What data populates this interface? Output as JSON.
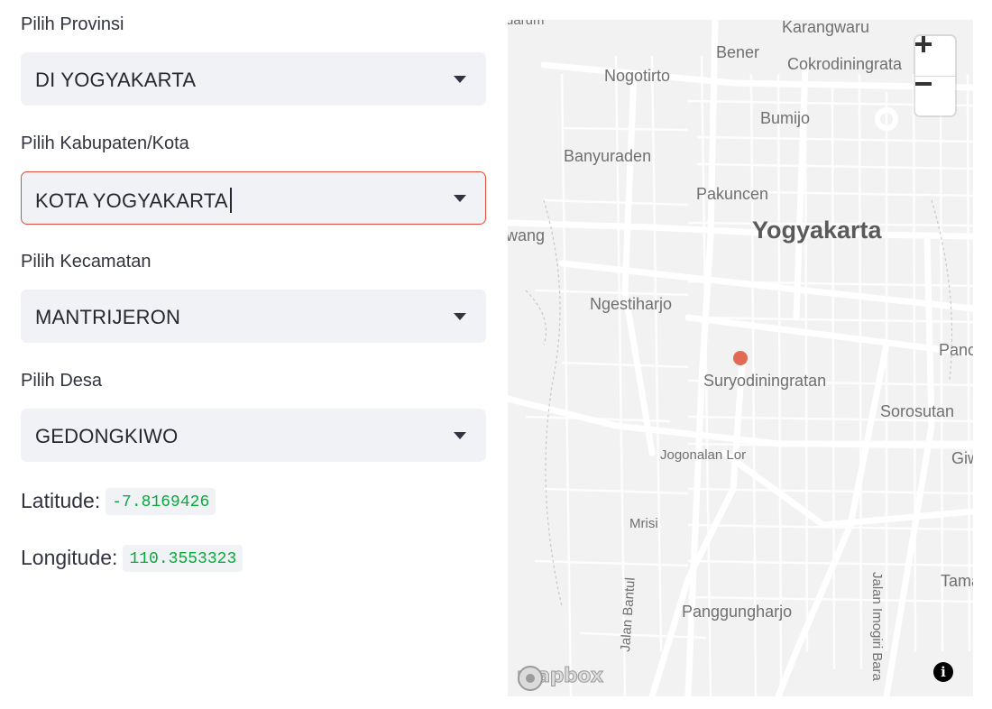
{
  "form": {
    "provinsi": {
      "label": "Pilih Provinsi",
      "value": "DI YOGYAKARTA"
    },
    "kabupaten": {
      "label": "Pilih Kabupaten/Kota",
      "value": "KOTA YOGYAKARTA"
    },
    "kecamatan": {
      "label": "Pilih Kecamatan",
      "value": "MANTRIJERON"
    },
    "desa": {
      "label": "Pilih Desa",
      "value": "GEDONGKIWO"
    }
  },
  "coords": {
    "latitude_label": "Latitude:",
    "latitude": "-7.8169426",
    "longitude_label": "Longitude:",
    "longitude": "110.3553323"
  },
  "map": {
    "labels": {
      "karangwaru": "Karangwaru",
      "bener": "Bener",
      "cokro": "Cokrodiningrata",
      "nogotirto": "Nogotirto",
      "bumijo": "Bumijo",
      "banyuraden": "Banyuraden",
      "pakuncen": "Pakuncen",
      "yogyakarta": "Yogyakarta",
      "wang": "wang",
      "ngestiharjo": "Ngestiharjo",
      "panc": "Panc",
      "suryodiningratan": "Suryodiningratan",
      "sorosutan": "Sorosutan",
      "jogonalan": "Jogonalan Lor",
      "giw": "Giw",
      "mrisi": "Mrisi",
      "tama": "Tama",
      "panggungharjo": "Panggungharjo",
      "jalanbantul": "Jalan Bantul",
      "jalanimogiri": "Jalan Imogiri Bara",
      "darum": "darum"
    },
    "attribution": "mapbox",
    "info_symbol": "i",
    "marker_color": "#e06a55"
  }
}
